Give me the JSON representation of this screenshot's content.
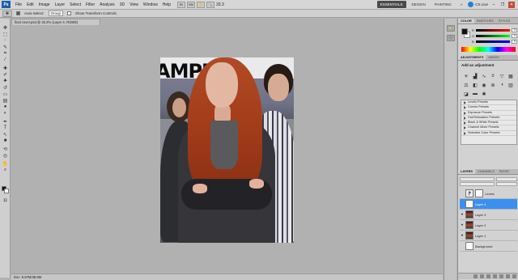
{
  "menubar": {
    "logo": "Ps",
    "items": [
      "File",
      "Edit",
      "Image",
      "Layer",
      "Select",
      "Filter",
      "Analysis",
      "3D",
      "View",
      "Window",
      "Help"
    ],
    "zoom": "33.3",
    "workspaces": [
      "ESSENTIALS",
      "DESIGN",
      "PAINTING"
    ],
    "cslive": "CS Live"
  },
  "options": {
    "auto_select_label": "Auto-Select:",
    "auto_select_value": "Group",
    "transform_label": "Show Transform Controls"
  },
  "document": {
    "tab_title": "final cover.psd @ 33.3% (Layer 4, RGB/8)",
    "banner_text": "AMPER",
    "status": "Doc: 8.87M/38.9M"
  },
  "panels": {
    "color_tabs": [
      "Color",
      "Swatches",
      "Styles"
    ],
    "sliders": [
      {
        "label": "R",
        "value": "0"
      },
      {
        "label": "G",
        "value": "0"
      },
      {
        "label": "B",
        "value": "0"
      }
    ],
    "adjust_tabs": [
      "Adjustments",
      "Masks"
    ],
    "adjust_title": "Add an adjustment",
    "presets": [
      "Levels Presets",
      "Curves Presets",
      "Exposure Presets",
      "Hue/Saturation Presets",
      "Black & White Presets",
      "Channel Mixer Presets",
      "Selective Color Presets"
    ],
    "layer_tabs": [
      "Layers",
      "Channels",
      "Paths"
    ],
    "layers": [
      {
        "name": "Levels",
        "thumb": "adj",
        "selected": false,
        "visible": false
      },
      {
        "name": "Layer 4",
        "thumb": "white",
        "selected": true,
        "visible": false
      },
      {
        "name": "Layer 3",
        "thumb": "photo",
        "selected": false,
        "visible": true
      },
      {
        "name": "Layer 2",
        "thumb": "photo",
        "selected": false,
        "visible": true
      },
      {
        "name": "Layer 1",
        "thumb": "photo",
        "selected": false,
        "visible": true
      },
      {
        "name": "Background",
        "thumb": "white",
        "selected": false,
        "visible": false
      }
    ]
  },
  "colors": {
    "selection_blue": "#3a8ff2",
    "hair": "#a33c1a",
    "workspace_bg": "#b1b1b1"
  }
}
